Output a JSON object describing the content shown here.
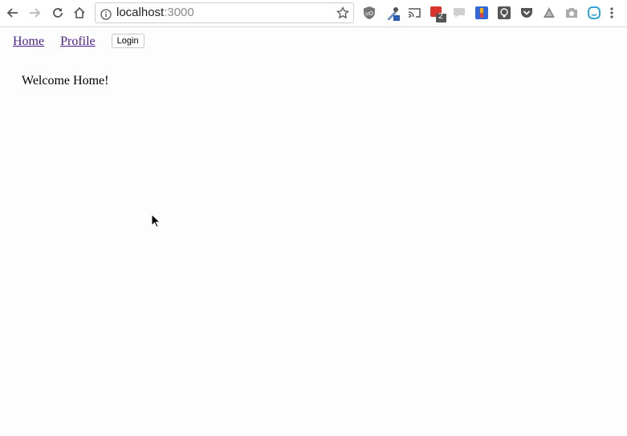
{
  "browser": {
    "url_host": "localhost",
    "url_port": ":3000",
    "extension_badge": "2",
    "icons": [
      "back-icon",
      "forward-icon",
      "reload-icon",
      "home-icon",
      "info-icon",
      "star-icon",
      "more-icon"
    ]
  },
  "nav": {
    "home_label": "Home",
    "profile_label": "Profile",
    "login_label": "Login"
  },
  "main": {
    "welcome_text": "Welcome Home!"
  },
  "colors": {
    "link": "#4b1c8c",
    "toolbar_border": "#d6d6d6"
  }
}
